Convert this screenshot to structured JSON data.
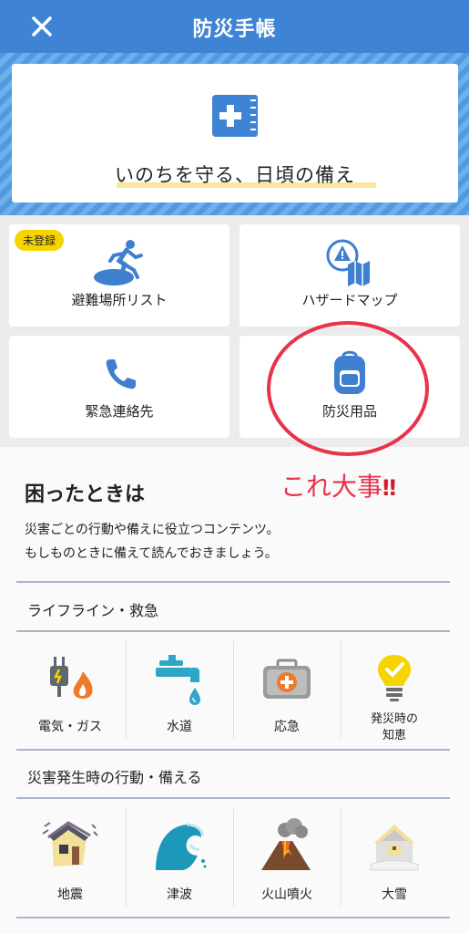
{
  "header": {
    "title": "防災手帳"
  },
  "hero": {
    "tagline": "いのちを守る、日頃の備え"
  },
  "menu": [
    {
      "label": "避難場所リスト",
      "badge": "未登録",
      "icon": "evacuation-icon"
    },
    {
      "label": "ハザードマップ",
      "icon": "hazard-map-icon"
    },
    {
      "label": "緊急連絡先",
      "icon": "phone-icon"
    },
    {
      "label": "防災用品",
      "icon": "backpack-icon"
    }
  ],
  "annotation": {
    "text": "これ大事",
    "marks": "‼︎"
  },
  "trouble": {
    "title": "困ったときは",
    "desc_line1": "災害ごとの行動や備えに役立つコンテンツ。",
    "desc_line2": "もしものときに備えて読んでおきましょう。"
  },
  "sections": [
    {
      "title": "ライフライン・救急",
      "items": [
        {
          "label": "電気・ガス",
          "icon": "plug-flame-icon"
        },
        {
          "label": "水道",
          "icon": "faucet-icon"
        },
        {
          "label": "応急",
          "icon": "first-aid-kit-icon"
        },
        {
          "label_line1": "発災時の",
          "label_line2": "知恵",
          "icon": "lightbulb-icon"
        }
      ]
    },
    {
      "title": "災害発生時の行動・備える",
      "items": [
        {
          "label": "地震",
          "icon": "earthquake-house-icon"
        },
        {
          "label": "津波",
          "icon": "tsunami-wave-icon"
        },
        {
          "label": "火山噴火",
          "icon": "volcano-icon"
        },
        {
          "label": "大雪",
          "icon": "snow-house-icon"
        }
      ]
    }
  ],
  "colors": {
    "header": "#3f84d4",
    "accent": "#3f7fcf",
    "annotation": "#e8334a",
    "badge": "#f6d400"
  }
}
